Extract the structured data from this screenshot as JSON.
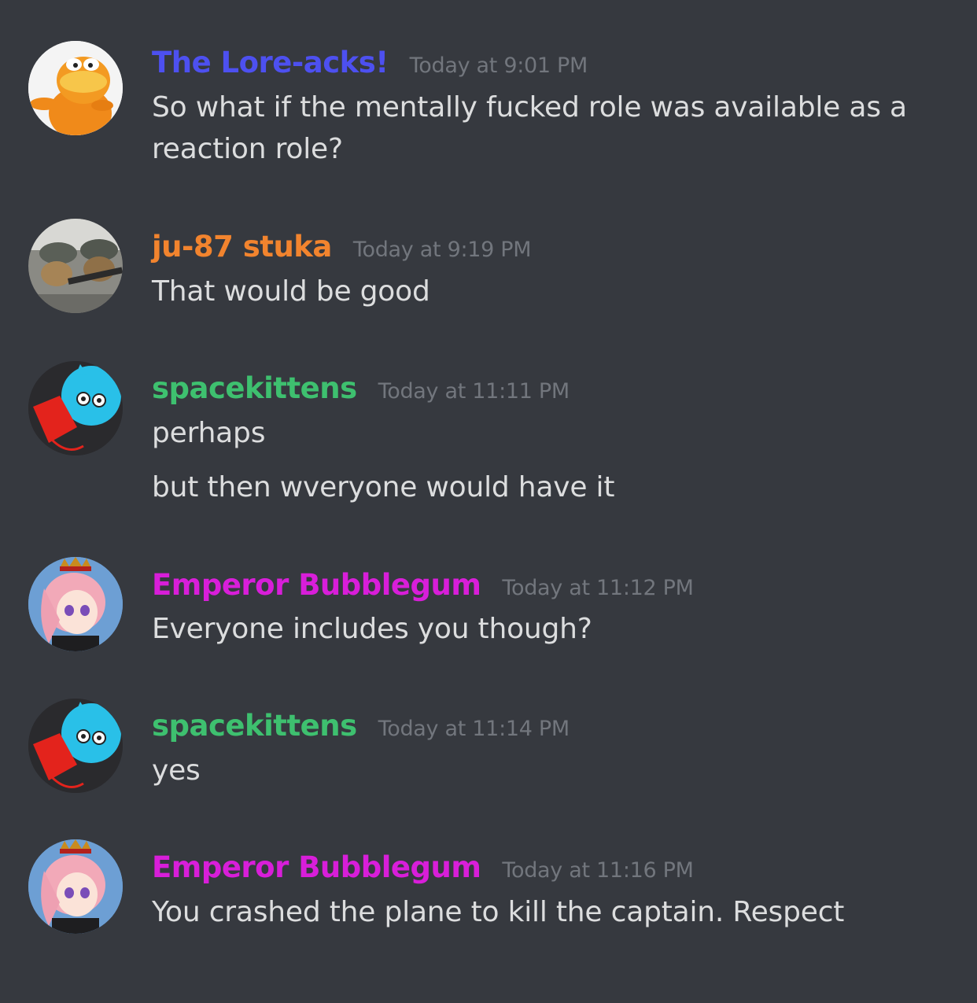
{
  "colors": {
    "background": "#36393f",
    "message_text": "#dcddde",
    "timestamp": "#72767d"
  },
  "messages": [
    {
      "username": "The Lore-acks!",
      "username_color": "#4d50f0",
      "timestamp": "Today at 9:01 PM",
      "lines": [
        "So what if the mentally fucked role was available as a reaction role?"
      ],
      "avatar_icon": "lorax-avatar"
    },
    {
      "username": "ju-87 stuka",
      "username_color": "#f2842e",
      "timestamp": "Today at 9:19 PM",
      "lines": [
        "That would be good"
      ],
      "avatar_icon": "soldier-dog-avatar"
    },
    {
      "username": "spacekittens",
      "username_color": "#3ec06f",
      "timestamp": "Today at 11:11 PM",
      "lines": [
        "perhaps",
        "but then wveryone would have it"
      ],
      "avatar_icon": "blue-cat-avatar"
    },
    {
      "username": "Emperor Bubblegum",
      "username_color": "#d81ed9",
      "timestamp": "Today at 11:12 PM",
      "lines": [
        "Everyone includes you though?"
      ],
      "avatar_icon": "anime-crown-avatar"
    },
    {
      "username": "spacekittens",
      "username_color": "#3ec06f",
      "timestamp": "Today at 11:14 PM",
      "lines": [
        "yes"
      ],
      "avatar_icon": "blue-cat-avatar"
    },
    {
      "username": "Emperor Bubblegum",
      "username_color": "#d81ed9",
      "timestamp": "Today at 11:16 PM",
      "lines": [
        "You crashed the plane to kill the captain. Respect"
      ],
      "avatar_icon": "anime-crown-avatar"
    }
  ]
}
